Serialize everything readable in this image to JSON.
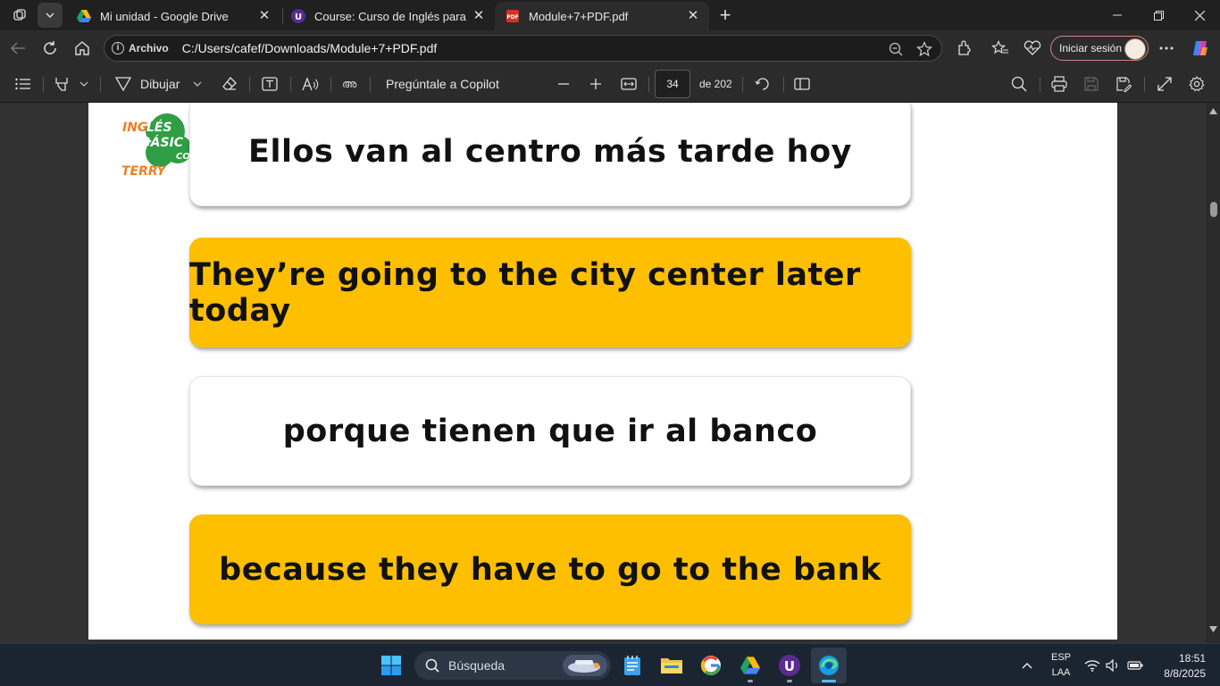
{
  "tabs": [
    {
      "title": "Mi unidad - Google Drive",
      "icon": "google-drive-icon",
      "close": "✕"
    },
    {
      "title": "Course: Curso de Inglés para principiantes",
      "icon": "course-icon",
      "close": "✕"
    },
    {
      "title": "Module+7+PDF.pdf",
      "icon": "pdf-icon",
      "close": "✕",
      "active": true
    }
  ],
  "new_tab": "+",
  "address": {
    "info_label": "Archivo",
    "url": "C:/Users/cafef/Downloads/Module+7+PDF.pdf"
  },
  "profile": {
    "signin_label": "Iniciar sesión"
  },
  "pdf_toolbar": {
    "draw_label": "Dibujar",
    "copilot_label": "Pregúntale a Copilot",
    "page_current": "34",
    "page_total": "de 202"
  },
  "pdf_page": {
    "logo": {
      "line1": "INGLÉS",
      "line2": "BÁSICO",
      "line3": "CON",
      "line4": "TERRY"
    },
    "cards": [
      {
        "text": "Ellos van al centro más tarde hoy",
        "style": "white"
      },
      {
        "text": "They’re going to the city center later today",
        "style": "yellow"
      },
      {
        "text": "porque tienen que ir al banco",
        "style": "white"
      },
      {
        "text": "because they have to go to the bank",
        "style": "yellow"
      }
    ]
  },
  "taskbar": {
    "search_placeholder": "Búsqueda",
    "lang_top": "ESP",
    "lang_bottom": "LAA",
    "time": "18:51",
    "date": "8/8/2025"
  },
  "colors": {
    "card_yellow": "#fdbf00",
    "logo_green": "#2f9e44",
    "logo_orange": "#f07f22"
  }
}
